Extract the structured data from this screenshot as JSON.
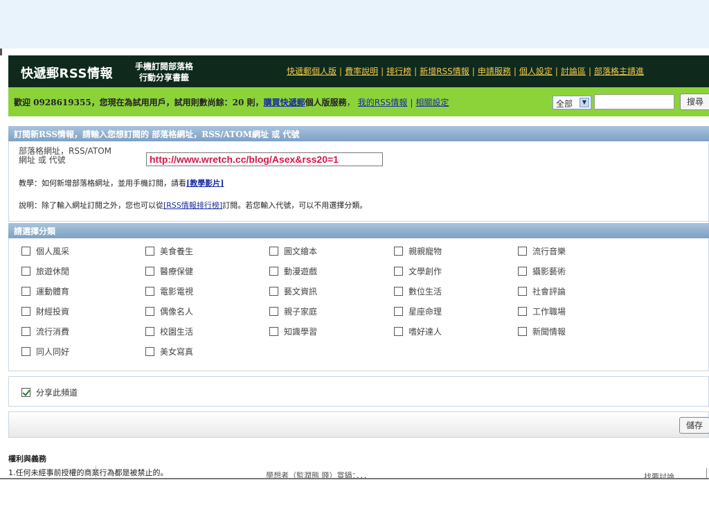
{
  "header": {
    "logo": "快遞郵RSS情報",
    "slogan_line1": "手機訂閱部落格",
    "slogan_line2": "行動分享書籤",
    "nav": [
      "快遞郵個人版",
      "費率說明",
      "排行榜",
      "新增RSS情報",
      "申請服務",
      "個人設定",
      "討論區",
      "部落格主請進"
    ]
  },
  "greenbar": {
    "welcome_prefix": "歡迎 0928619355，您現在為試用用戶，試用則數尚餘：20 則，",
    "buy_link": "購買快遞郵",
    "service_text": "個人版服務",
    "my_rss_link": "我的RSS情報",
    "related_link": "相關設定",
    "filter_value": "全部",
    "search_button": "搜尋"
  },
  "subscribe": {
    "section_title": "訂閱新RSS情報，請輸入您想訂閱的 部落格網址，RSS/ATOM網址 或 代號",
    "url_label_line1": "部落格網址，RSS/ATOM",
    "url_label_line2": "網址 或 代號",
    "url_value": "http://www.wretch.cc/blog/Asex&rss20=1",
    "tutorial_text": "教學：如何新增部落格網址，並用手機訂閱，請看",
    "tutorial_link": "[教學影片]",
    "note_prefix": "說明：除了輸入網址訂閱之外，您也可以從",
    "note_link": "[RSS情報排行榜]",
    "note_suffix": "訂閱。若您輸入代號，可以不用選擇分類。"
  },
  "categories": {
    "section_title": "請選擇分類",
    "items": [
      "個人風采",
      "美食養生",
      "圖文繪本",
      "親親寵物",
      "流行音樂",
      "旅遊休閒",
      "醫療保健",
      "動漫遊戲",
      "文學創作",
      "攝影藝術",
      "運動體育",
      "電影電視",
      "藝文資訊",
      "數位生活",
      "社會評論",
      "財經投資",
      "偶像名人",
      "親子家庭",
      "星座命理",
      "工作職場",
      "流行消費",
      "校園生活",
      "知識學習",
      "嗜好達人",
      "新聞情報",
      "同人同好",
      "美女寫真"
    ]
  },
  "share": {
    "label": "分享此頻道",
    "checked": true
  },
  "save_button": "儲存",
  "rights": {
    "title": "權利與義務",
    "line1": "1.任何未經事前授權的商業行為都是被禁止的。"
  },
  "fragments": {
    "left": "學想者（監潤態 賤）賞鍋：．．．",
    "right": "找要討論"
  }
}
